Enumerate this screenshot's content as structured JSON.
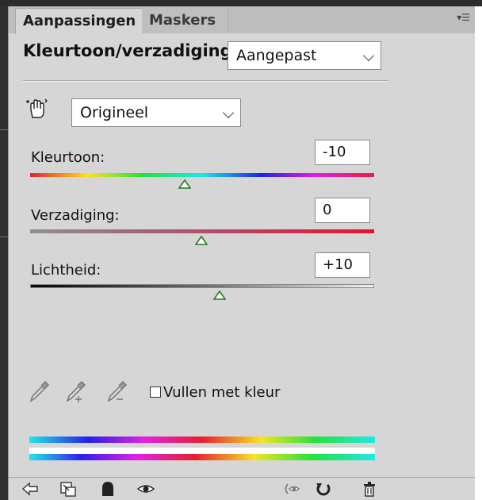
{
  "tabs": [
    {
      "label": "Aanpassingen",
      "active": true
    },
    {
      "label": "Maskers",
      "active": false
    }
  ],
  "panel_menu_icon": "panel-menu-icon",
  "header": {
    "title": "Kleurtoon/verzadiging",
    "preset_selected": "Aangepast"
  },
  "channel": {
    "icon": "targeted-adjustment-hand-icon",
    "selected": "Origineel"
  },
  "sliders": [
    {
      "label": "Kleurtoon:",
      "value": "-10"
    },
    {
      "label": "Verzadiging:",
      "value": "0"
    },
    {
      "label": "Lichtheid:",
      "value": "+10"
    }
  ],
  "colorize": {
    "label": "Vullen met kleur",
    "checked": false
  },
  "eyedroppers": [
    "eyedropper-icon",
    "eyedropper-plus-icon",
    "eyedropper-minus-icon"
  ],
  "footer_icons": [
    "back-arrow-icon",
    "clip-to-layer-icon",
    "layer-visibility-mask-icon",
    "eye-icon",
    "view-previous-state-icon",
    "reset-icon",
    "trash-icon"
  ]
}
